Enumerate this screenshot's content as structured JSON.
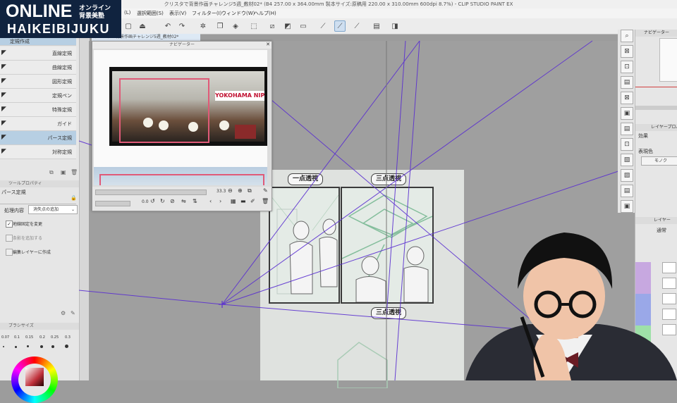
{
  "logo": {
    "online": "ONLINE",
    "jp_line1": "オンライン",
    "jp_line2": "背景美塾",
    "haikei": "HAIKEIBIJUKU"
  },
  "window": {
    "title": "クリスタで背景作画チャレンジ5週_教材02* (B4 257.00 x 364.00mm 製本サイズ:原稿用 220.00 x 310.00mm 600dpi 8.7%) - CLIP STUDIO PAINT EX"
  },
  "menu": [
    "(L)",
    "選択範囲(S)",
    "表示(V)",
    "フィルター(I)",
    "ウィンドウ(W)",
    "ヘルプ(H)"
  ],
  "document_tab": "クリスタで背景作画チャレンジ5週_教材02*",
  "sub_tools": [
    {
      "label": "定規作成",
      "selected": true
    },
    {
      "label": "直線定規",
      "selected": false
    },
    {
      "label": "曲線定規",
      "selected": false
    },
    {
      "label": "図形定規",
      "selected": false
    },
    {
      "label": "定規ペン",
      "selected": false
    },
    {
      "label": "特殊定規",
      "selected": false
    },
    {
      "label": "ガイド",
      "selected": false
    },
    {
      "label": "パース定規",
      "selected": true
    },
    {
      "label": "対称定規",
      "selected": false
    }
  ],
  "tool_property": {
    "panel_title": "ツールプロパティ",
    "tool_name": "パース定規",
    "process_label": "処理内容",
    "process_value": "消失点の追加",
    "opt1": "地線固定を変更",
    "opt2": "条影を追加する",
    "opt3": "編集レイヤーに作成"
  },
  "brush_size": {
    "panel_title": "ブラシサイズ",
    "values": [
      "0.07",
      "0.1",
      "0.15",
      "0.2",
      "0.25",
      "0.3"
    ]
  },
  "navigator": {
    "title": "ナビゲーター",
    "zoom": "33.3",
    "angle": "0.0",
    "photo_sign": "YOKOHAMA NIPPON"
  },
  "canvas": {
    "caption_one_point": "一点透視",
    "caption_three_point_top": "三点透視",
    "caption_three_point_bottom": "三点透視"
  },
  "right_panel": {
    "navigator_tab": "ナビゲーター",
    "layer_property_tab": "レイヤープロパティ",
    "effect_label": "効果",
    "express_color_label": "表現色",
    "express_color_value": "モノク",
    "layer_tab": "レイヤー",
    "blend_mode": "通常"
  },
  "colors": {
    "logo_bg": "#10233f",
    "perspective_line": "#5a2fd0",
    "selection": "#b7cfe3",
    "nav_frame": "#e05a78"
  }
}
